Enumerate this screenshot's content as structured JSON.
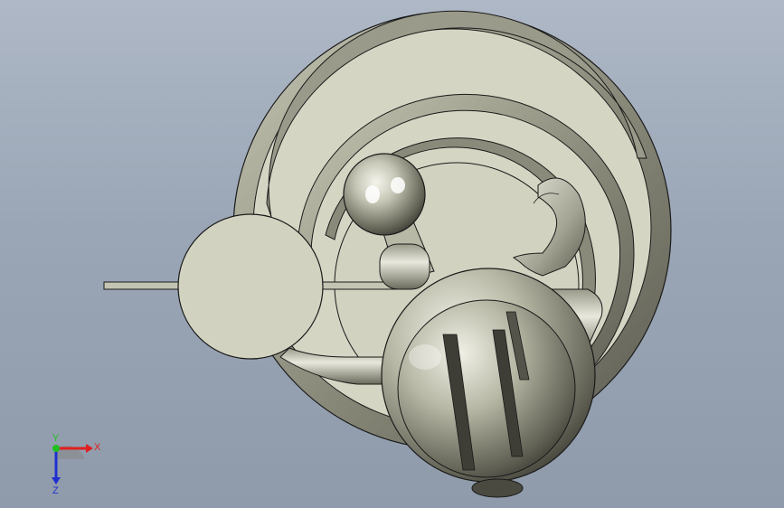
{
  "viewport": {
    "background_top": "#aeb8c6",
    "background_bottom": "#8f9bab"
  },
  "model": {
    "edge_color": "#1a1a1a",
    "face_color_light": "#d8d8c8",
    "face_color_mid": "#b0b09a",
    "face_color_dark": "#6e6e60"
  },
  "triad": {
    "x_label": "X",
    "y_label": "Y",
    "z_label": "Z",
    "x_color": "#e02020",
    "y_color": "#20c020",
    "z_color": "#2030d0"
  }
}
